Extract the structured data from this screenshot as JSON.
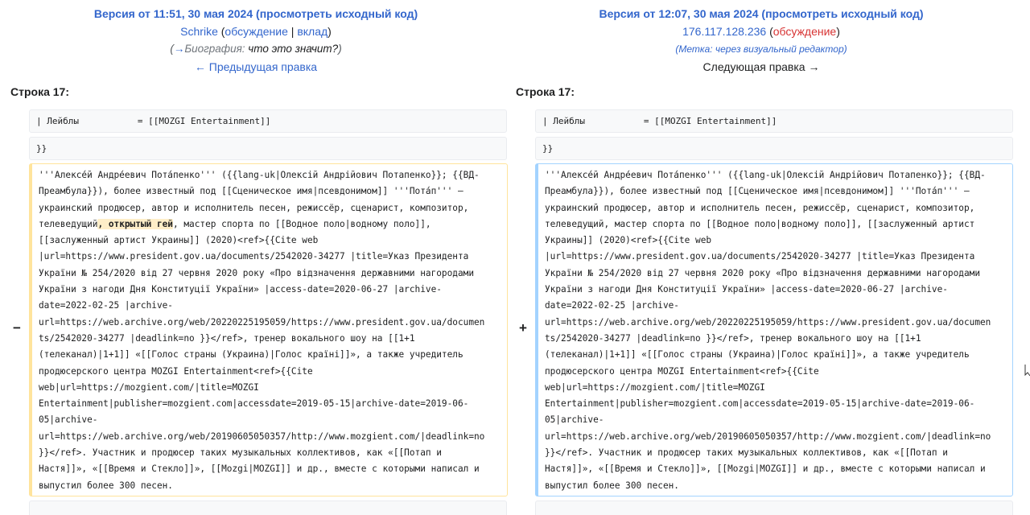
{
  "left": {
    "title_prefix": "Версия от 11:51, 30 мая 2024",
    "title_link": "(просмотреть исходный код)",
    "user": "Schrike",
    "user_open": " (",
    "talk": "обсуждение",
    "sep": " | ",
    "contribs": "вклад",
    "user_close": ")",
    "summary_open": "(",
    "summary_arrow": "→",
    "summary_section": "Биография:",
    "summary_text": " что это значит?",
    "summary_close": ")",
    "nav": "← Предыдущая правка",
    "line_label": "Строка 17:",
    "ctx1": "| Лейблы           = [[MOZGI Entertainment]]",
    "ctx2": "}}",
    "marker": "−",
    "diff_before": "'''Алексе́й Андре́евич Пота́пенко''' ({{lang-uk|Олексій Андрійович Потапенко}}; {{ВД-\nПреамбула}}), более известный под [[Сценическое имя|псевдонимом]] '''Пота́п''' —\nукраинский продюсер, автор и исполнитель песен, режиссёр, сценарист, композитор,\nтелеведущий",
    "diff_highlight": ", открытый гей",
    "diff_after": ", мастер спорта по [[Водное поло|водному поло]],\n[[заслуженный артист Украины]] (2020)<ref>{{Cite web\n|url=https://www.president.gov.ua/documents/2542020-34277 |title=Указ Президента\nУкраїни № 254/2020 від 27 червня 2020 року «Про відзначення державними нагородами\nУкраїни з нагоди Дня Конституції України» |access-date=2020-06-27 |archive-\ndate=2022-02-25 |archive-\nurl=https://web.archive.org/web/20220225195059/https://www.president.gov.ua/documen\nts/2542020-34277 |deadlink=no }}</ref>, тренер вокального шоу на [[1+1\n(телеканал)|1+1]] «[[Голос страны (Украина)|Голос країні]]», а также учредитель\nпродюсерского центра MOZGI Entertainment<ref>{{Cite\nweb|url=https://mozgient.com/|title=MOZGI\nEntertainment|publisher=mozgient.com|accessdate=2019-05-15|archive-date=2019-06-\n05|archive-\nurl=https://web.archive.org/web/20190605050357/http://www.mozgient.com/|deadlink=no\n}}</ref>. Участник и продюсер таких музыкальных коллективов, как «[[Потап и\nНастя]]», «[[Время и Стекло]]», [[Mozgi|MOZGI]] и др., вместе с которыми написал и\nвыпустил более 300 песен."
  },
  "right": {
    "title_prefix": "Версия от 12:07, 30 мая 2024",
    "title_link": "(просмотреть исходный код)",
    "user": "176.117.128.236",
    "user_open": " (",
    "talk": "обсуждение",
    "user_close": ")",
    "tags": "(Метка: через визуальный редактор)",
    "nav": "Следующая правка →",
    "line_label": "Строка 17:",
    "ctx1": "| Лейблы           = [[MOZGI Entertainment]]",
    "ctx2": "}}",
    "marker": "+",
    "diff_text": "'''Алексе́й Андре́евич Пота́пенко''' ({{lang-uk|Олексій Андрійович Потапенко}}; {{ВД-\nПреамбула}}), более известный под [[Сценическое имя|псевдонимом]] '''Пота́п''' —\nукраинский продюсер, автор и исполнитель песен, режиссёр, сценарист, композитор,\nтелеведущий, мастер спорта по [[Водное поло|водному поло]], [[заслуженный артист\nУкраины]] (2020)<ref>{{Cite web\n|url=https://www.president.gov.ua/documents/2542020-34277 |title=Указ Президента\nУкраїни № 254/2020 від 27 червня 2020 року «Про відзначення державними нагородами\nУкраїни з нагоди Дня Конституції України» |access-date=2020-06-27 |archive-\ndate=2022-02-25 |archive-\nurl=https://web.archive.org/web/20220225195059/https://www.president.gov.ua/documen\nts/2542020-34277 |deadlink=no }}</ref>, тренер вокального шоу на [[1+1\n(телеканал)|1+1]] «[[Голос страны (Украина)|Голос країні]]», а также учредитель\nпродюсерского центра MOZGI Entertainment<ref>{{Cite\nweb|url=https://mozgient.com/|title=MOZGI\nEntertainment|publisher=mozgient.com|accessdate=2019-05-15|archive-date=2019-06-\n05|archive-\nurl=https://web.archive.org/web/20190605050357/http://www.mozgient.com/|deadlink=no\n}}</ref>. Участник и продюсер таких музыкальных коллективов, как «[[Потап и\nНастя]]», «[[Время и Стекло]]», [[Mozgi|MOZGI]] и др., вместе с которыми написал и\nвыпустил более 300 песен."
  },
  "colors": {
    "link": "#3366cc",
    "deleted_border": "#ffe49c",
    "added_border": "#a3d3ff",
    "highlight_bg": "#feeec8",
    "talk_red": "#d73333"
  }
}
